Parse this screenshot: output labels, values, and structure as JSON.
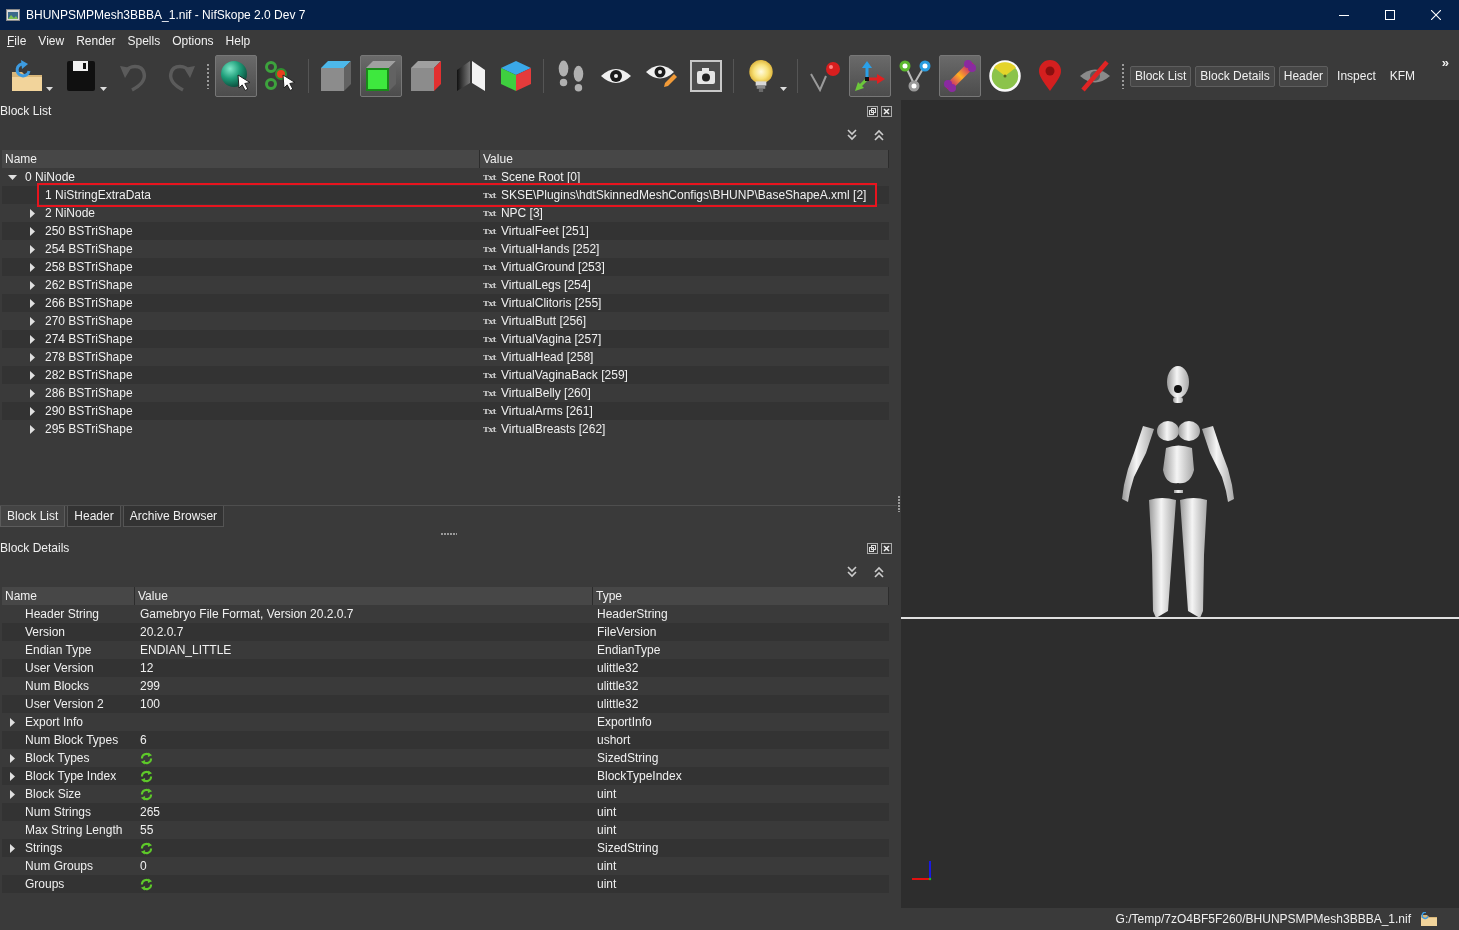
{
  "window": {
    "title": "BHUNPSMPMesh3BBBA_1.nif - NifSkope 2.0 Dev 7"
  },
  "menu": [
    {
      "label": "File",
      "mnemonic": true
    },
    {
      "label": "View",
      "mnemonic": false
    },
    {
      "label": "Render",
      "mnemonic": false
    },
    {
      "label": "Spells",
      "mnemonic": false
    },
    {
      "label": "Options",
      "mnemonic": false
    },
    {
      "label": "Help",
      "mnemonic": false
    }
  ],
  "toolbars": [
    {
      "groups": [
        {
          "tools": [
            {
              "kind": "open",
              "checked": false,
              "disabled": false,
              "dropdown": true
            },
            {
              "kind": "save",
              "checked": false,
              "disabled": false,
              "dropdown": true
            },
            {
              "kind": "undo",
              "checked": false,
              "disabled": true,
              "dropdown": false
            },
            {
              "kind": "redo",
              "checked": false,
              "disabled": true,
              "dropdown": false
            }
          ]
        }
      ]
    },
    {
      "groups": [
        {
          "tools": [
            {
              "kind": "sphere",
              "checked": true,
              "disabled": false,
              "dropdown": false
            },
            {
              "kind": "points",
              "checked": false,
              "disabled": false,
              "dropdown": false
            }
          ]
        },
        {
          "tools": [
            {
              "kind": "cubetop",
              "checked": false,
              "disabled": false,
              "dropdown": false
            },
            {
              "kind": "cubefront",
              "checked": true,
              "disabled": false,
              "dropdown": false
            },
            {
              "kind": "cubeside",
              "checked": false,
              "disabled": false,
              "dropdown": false
            },
            {
              "kind": "planes",
              "checked": false,
              "disabled": false,
              "dropdown": false
            },
            {
              "kind": "colorcube",
              "checked": false,
              "disabled": false,
              "dropdown": false
            }
          ]
        },
        {
          "tools": [
            {
              "kind": "feet",
              "checked": false,
              "disabled": false,
              "dropdown": false
            },
            {
              "kind": "eye",
              "checked": false,
              "disabled": false,
              "dropdown": false
            },
            {
              "kind": "eyepencil",
              "checked": false,
              "disabled": false,
              "dropdown": false
            },
            {
              "kind": "camera",
              "checked": false,
              "disabled": false,
              "dropdown": false
            }
          ]
        },
        {
          "tools": [
            {
              "kind": "bulb",
              "checked": false,
              "disabled": false,
              "dropdown": true
            }
          ]
        },
        {
          "tools": [
            {
              "kind": "pin",
              "checked": false,
              "disabled": false,
              "dropdown": false
            },
            {
              "kind": "axes",
              "checked": true,
              "disabled": false,
              "dropdown": false
            },
            {
              "kind": "nodes",
              "checked": false,
              "disabled": false,
              "dropdown": false
            },
            {
              "kind": "bone",
              "checked": true,
              "disabled": false,
              "dropdown": false
            },
            {
              "kind": "gauge",
              "checked": false,
              "disabled": false,
              "dropdown": false
            },
            {
              "kind": "marker",
              "checked": false,
              "disabled": false,
              "dropdown": false
            },
            {
              "kind": "hidden",
              "checked": false,
              "disabled": false,
              "dropdown": false
            }
          ]
        }
      ]
    }
  ],
  "dock_buttons": [
    {
      "label": "Block List",
      "checked": true
    },
    {
      "label": "Block Details",
      "checked": true
    },
    {
      "label": "Header",
      "checked": true
    },
    {
      "label": "Inspect",
      "checked": false
    },
    {
      "label": "KFM",
      "checked": false
    }
  ],
  "overflow": "»",
  "block_list": {
    "title": "Block List",
    "columns": [
      "Name",
      "Value"
    ],
    "rows": [
      {
        "name": "0 NiNode",
        "expandable": true,
        "expanded": true,
        "value_icon": "Txt",
        "value": "Scene Root [0]",
        "highlighted": false,
        "children": [
          {
            "name": "1 NiStringExtraData",
            "expandable": false,
            "expanded": false,
            "value_icon": "Txt",
            "value": "SKSE\\Plugins\\hdtSkinnedMeshConfigs\\BHUNP\\BaseShapeA.xml [2]",
            "highlighted": true
          },
          {
            "name": "2 NiNode",
            "expandable": true,
            "expanded": false,
            "value_icon": "Txt",
            "value": "NPC [3]",
            "highlighted": false
          },
          {
            "name": "250 BSTriShape",
            "expandable": true,
            "expanded": false,
            "value_icon": "Txt",
            "value": "VirtualFeet [251]",
            "highlighted": false
          },
          {
            "name": "254 BSTriShape",
            "expandable": true,
            "expanded": false,
            "value_icon": "Txt",
            "value": "VirtualHands [252]",
            "highlighted": false
          },
          {
            "name": "258 BSTriShape",
            "expandable": true,
            "expanded": false,
            "value_icon": "Txt",
            "value": "VirtualGround [253]",
            "highlighted": false
          },
          {
            "name": "262 BSTriShape",
            "expandable": true,
            "expanded": false,
            "value_icon": "Txt",
            "value": "VirtualLegs [254]",
            "highlighted": false
          },
          {
            "name": "266 BSTriShape",
            "expandable": true,
            "expanded": false,
            "value_icon": "Txt",
            "value": "VirtualClitoris [255]",
            "highlighted": false
          },
          {
            "name": "270 BSTriShape",
            "expandable": true,
            "expanded": false,
            "value_icon": "Txt",
            "value": "VirtualButt [256]",
            "highlighted": false
          },
          {
            "name": "274 BSTriShape",
            "expandable": true,
            "expanded": false,
            "value_icon": "Txt",
            "value": "VirtualVagina [257]",
            "highlighted": false
          },
          {
            "name": "278 BSTriShape",
            "expandable": true,
            "expanded": false,
            "value_icon": "Txt",
            "value": "VirtualHead [258]",
            "highlighted": false
          },
          {
            "name": "282 BSTriShape",
            "expandable": true,
            "expanded": false,
            "value_icon": "Txt",
            "value": "VirtualVaginaBack [259]",
            "highlighted": false
          },
          {
            "name": "286 BSTriShape",
            "expandable": true,
            "expanded": false,
            "value_icon": "Txt",
            "value": "VirtualBelly [260]",
            "highlighted": false
          },
          {
            "name": "290 BSTriShape",
            "expandable": true,
            "expanded": false,
            "value_icon": "Txt",
            "value": "VirtualArms [261]",
            "highlighted": false
          },
          {
            "name": "295 BSTriShape",
            "expandable": true,
            "expanded": false,
            "value_icon": "Txt",
            "value": "VirtualBreasts [262]",
            "highlighted": false
          }
        ]
      }
    ]
  },
  "tabs": [
    {
      "label": "Block List",
      "selected": true
    },
    {
      "label": "Header",
      "selected": false
    },
    {
      "label": "Archive Browser",
      "selected": false
    }
  ],
  "block_details": {
    "title": "Block Details",
    "columns": [
      "Name",
      "Value",
      "Type"
    ],
    "rows": [
      {
        "name": "Header String",
        "expandable": false,
        "expanded": false,
        "kind": "text",
        "value": "Gamebryo File Format, Version 20.2.0.7",
        "type": "HeaderString"
      },
      {
        "name": "Version",
        "expandable": false,
        "expanded": false,
        "kind": "text",
        "value": "20.2.0.7",
        "type": "FileVersion"
      },
      {
        "name": "Endian Type",
        "expandable": false,
        "expanded": false,
        "kind": "text",
        "value": "ENDIAN_LITTLE",
        "type": "EndianType"
      },
      {
        "name": "User Version",
        "expandable": false,
        "expanded": false,
        "kind": "text",
        "value": "12",
        "type": "ulittle32"
      },
      {
        "name": "Num Blocks",
        "expandable": false,
        "expanded": false,
        "kind": "text",
        "value": "299",
        "type": "ulittle32"
      },
      {
        "name": "User Version 2",
        "expandable": false,
        "expanded": false,
        "kind": "text",
        "value": "100",
        "type": "ulittle32"
      },
      {
        "name": "Export Info",
        "expandable": true,
        "expanded": false,
        "kind": "text",
        "type": "ExportInfo"
      },
      {
        "name": "Num Block Types",
        "expandable": false,
        "expanded": false,
        "kind": "text",
        "value": "6",
        "type": "ushort"
      },
      {
        "name": "Block Types",
        "expandable": true,
        "expanded": false,
        "kind": "array",
        "type": "SizedString"
      },
      {
        "name": "Block Type Index",
        "expandable": true,
        "expanded": false,
        "kind": "array",
        "type": "BlockTypeIndex"
      },
      {
        "name": "Block Size",
        "expandable": true,
        "expanded": false,
        "kind": "array",
        "type": "uint"
      },
      {
        "name": "Num Strings",
        "expandable": false,
        "expanded": false,
        "kind": "text",
        "value": "265",
        "type": "uint"
      },
      {
        "name": "Max String Length",
        "expandable": false,
        "expanded": false,
        "kind": "text",
        "value": "55",
        "type": "uint"
      },
      {
        "name": "Strings",
        "expandable": true,
        "expanded": false,
        "kind": "array",
        "type": "SizedString"
      },
      {
        "name": "Num Groups",
        "expandable": false,
        "expanded": false,
        "kind": "text",
        "value": "0",
        "type": "uint"
      },
      {
        "name": "Groups",
        "expandable": false,
        "expanded": false,
        "kind": "array",
        "type": "uint"
      }
    ]
  },
  "status_bar": {
    "path": "G:/Temp/7zO4BF5F260/BHUNPSMPMesh3BBBA_1.nif"
  }
}
